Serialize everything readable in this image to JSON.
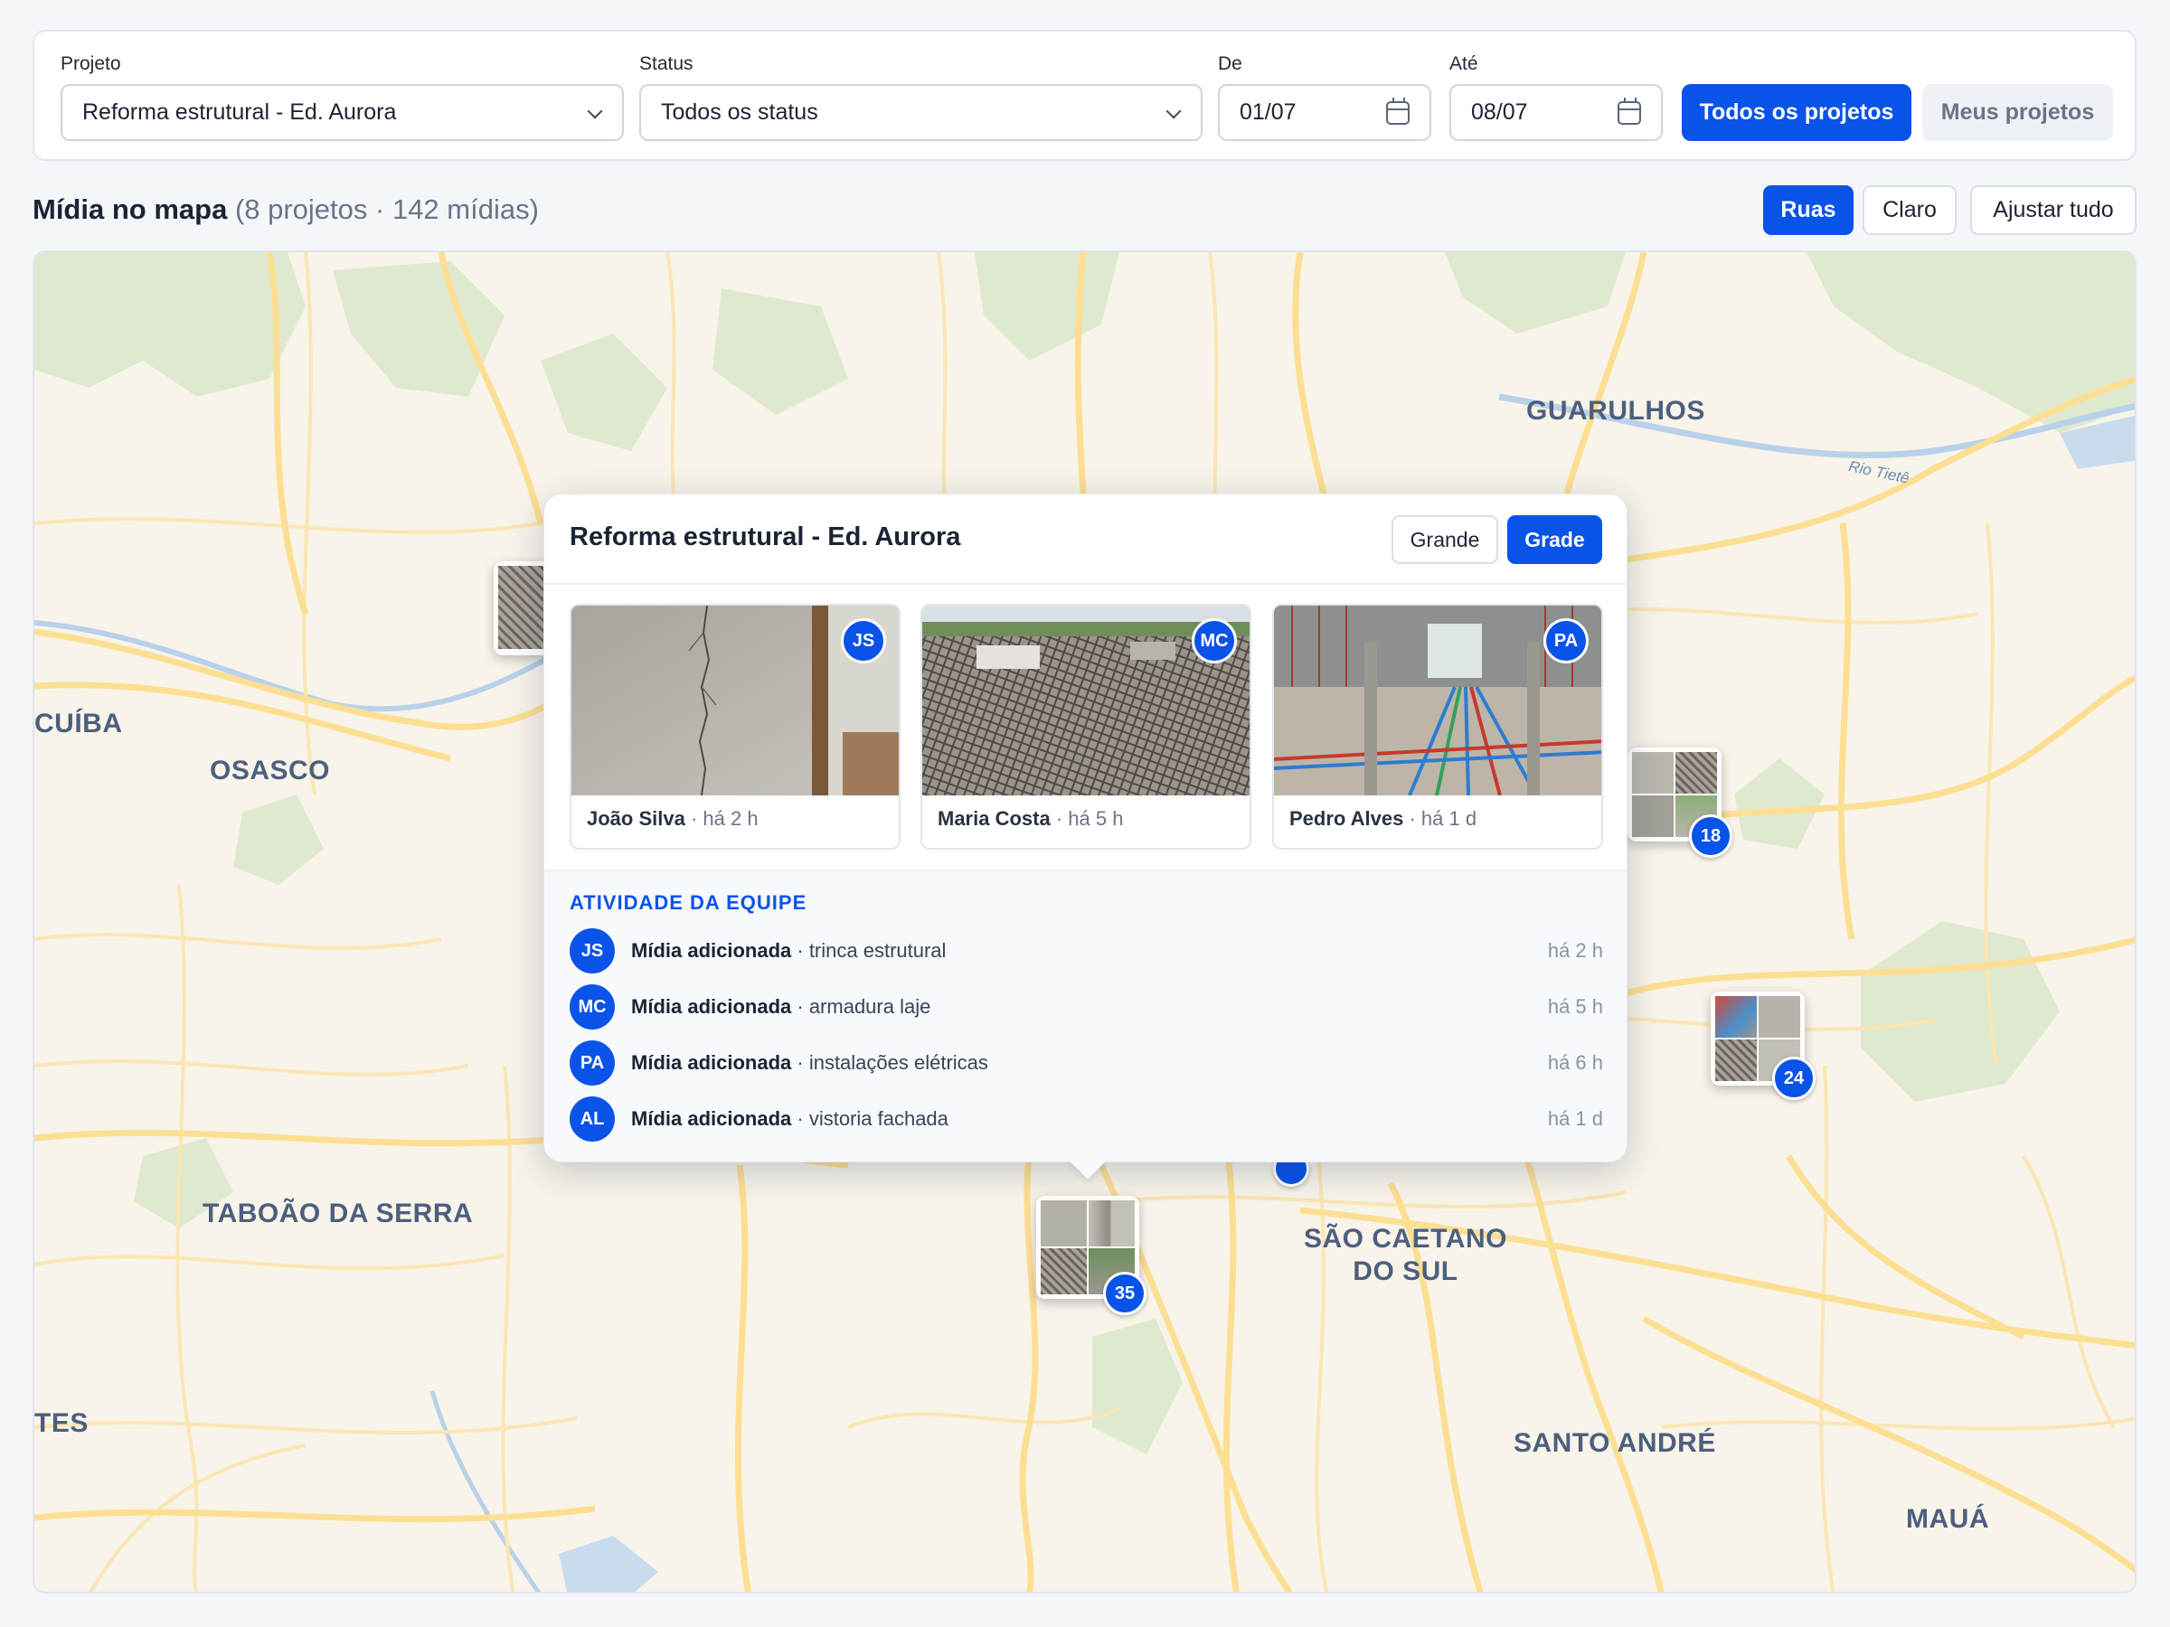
{
  "filters": {
    "project_label": "Projeto",
    "project_value": "Reforma estrutural - Ed. Aurora",
    "status_label": "Status",
    "status_value": "Todos os status",
    "from_label": "De",
    "from_value": "01/07",
    "to_label": "Até",
    "to_value": "08/07",
    "all_projects": "Todos os projetos",
    "my_projects": "Meus projetos"
  },
  "section": {
    "title": "Mídia no mapa",
    "subtitle": "(8 projetos · 142 mídias)",
    "style_streets": "Ruas",
    "style_light": "Claro",
    "fit_all": "Ajustar tudo"
  },
  "map": {
    "cities": {
      "guarulhos": "GUARULHOS",
      "osasco": "OSASCO",
      "cuiba": "CUÍBA",
      "taboao": "TABOÃO DA SERRA",
      "sao_caetano_1": "SÃO CAETANO",
      "sao_caetano_2": "DO SUL",
      "santo_andre": "SANTO ANDRÉ",
      "maua": "MAUÁ",
      "tes": "TES"
    },
    "river": "Rio Tietê",
    "clusters": [
      "18",
      "24",
      "35"
    ]
  },
  "popup": {
    "title": "Reforma estrutural - Ed. Aurora",
    "view_large": "Grande",
    "view_grid": "Grade",
    "cards": [
      {
        "initials": "JS",
        "author": "João Silva",
        "time": "· há 2 h"
      },
      {
        "initials": "MC",
        "author": "Maria Costa",
        "time": "· há 5 h"
      },
      {
        "initials": "PA",
        "author": "Pedro Alves",
        "time": "· há 1 d"
      }
    ],
    "activity_title": "ATIVIDADE DA EQUIPE",
    "activity": [
      {
        "initials": "JS",
        "action": "Mídia adicionada",
        "detail": " · trinca estrutural",
        "time": "há 2 h"
      },
      {
        "initials": "MC",
        "action": "Mídia adicionada",
        "detail": " · armadura laje",
        "time": "há 5 h"
      },
      {
        "initials": "PA",
        "action": "Mídia adicionada",
        "detail": " · instalações elétricas",
        "time": "há 6 h"
      },
      {
        "initials": "AL",
        "action": "Mídia adicionada",
        "detail": " · vistoria fachada",
        "time": "há 1 d"
      }
    ]
  },
  "colors": {
    "accent": "#0a53e8",
    "map_land": "#f8f4ea",
    "map_park": "#dfe9cf",
    "map_road": "#fde3a2"
  }
}
